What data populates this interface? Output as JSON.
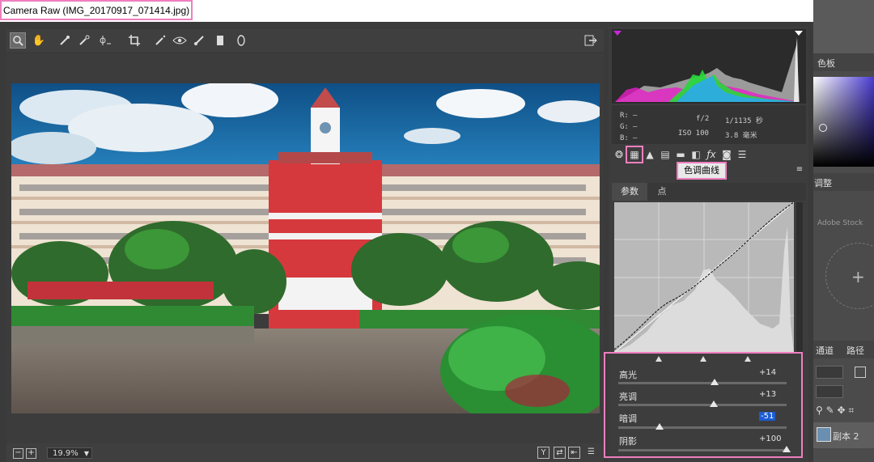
{
  "window": {
    "title": "Camera Raw (IMG_20170917_071414.jpg)"
  },
  "toolbar": {
    "tools": [
      {
        "name": "zoom",
        "glyph": "🔍"
      },
      {
        "name": "hand",
        "glyph": "✋"
      },
      {
        "name": "white-balance",
        "glyph": "✎"
      },
      {
        "name": "color-sampler",
        "glyph": "✐"
      },
      {
        "name": "targeted-adjust",
        "glyph": "⊹"
      },
      {
        "name": "crop",
        "glyph": "⌗"
      },
      {
        "name": "spot-removal",
        "glyph": "✦"
      },
      {
        "name": "red-eye",
        "glyph": "◉"
      },
      {
        "name": "brush",
        "glyph": "✏"
      },
      {
        "name": "graduated-filter",
        "glyph": "▮"
      },
      {
        "name": "radial-filter",
        "glyph": "◯"
      }
    ],
    "export_glyph": "⇥"
  },
  "histogram": {
    "r_label": "R:",
    "g_label": "G:",
    "b_label": "B:",
    "r_value": "—",
    "g_value": "—",
    "b_value": "—",
    "aperture": "f/2",
    "shutter": "1/1135 秒",
    "iso": "ISO 100",
    "focal": "3.8 毫米"
  },
  "panel_tabs": [
    {
      "name": "basic",
      "glyph": "❂"
    },
    {
      "name": "tone-curve",
      "glyph": "▦"
    },
    {
      "name": "detail",
      "glyph": "▲"
    },
    {
      "name": "hsl",
      "glyph": "▤"
    },
    {
      "name": "split-toning",
      "glyph": "▬"
    },
    {
      "name": "lens",
      "glyph": "◧"
    },
    {
      "name": "effects",
      "glyph": "ƒx"
    },
    {
      "name": "camera-calibration",
      "glyph": "◙"
    },
    {
      "name": "presets",
      "glyph": "☰"
    }
  ],
  "tooltip": "色调曲线",
  "subtabs": {
    "params": "参数",
    "point": "点"
  },
  "sliders": [
    {
      "id": "highlights",
      "label": "高光",
      "value": "+14",
      "position": 0.57
    },
    {
      "id": "lights",
      "label": "亮调",
      "value": "+13",
      "position": 0.565
    },
    {
      "id": "darks",
      "label": "暗调",
      "value": "-51",
      "position": 0.245
    },
    {
      "id": "shadows",
      "label": "阴影",
      "value": "+100",
      "position": 1.0
    }
  ],
  "status": {
    "zoom": "19.9%"
  },
  "ps": {
    "swatches_tab": "色板",
    "adjust_tab": "调整",
    "adobe_stock": "Adobe Stock",
    "channels_tab": "通道",
    "paths_tab": "路径",
    "layer_name": "副本 2"
  },
  "colors": {
    "highlight": "#ee7fbf",
    "selected_value": "#1c5bd4"
  }
}
